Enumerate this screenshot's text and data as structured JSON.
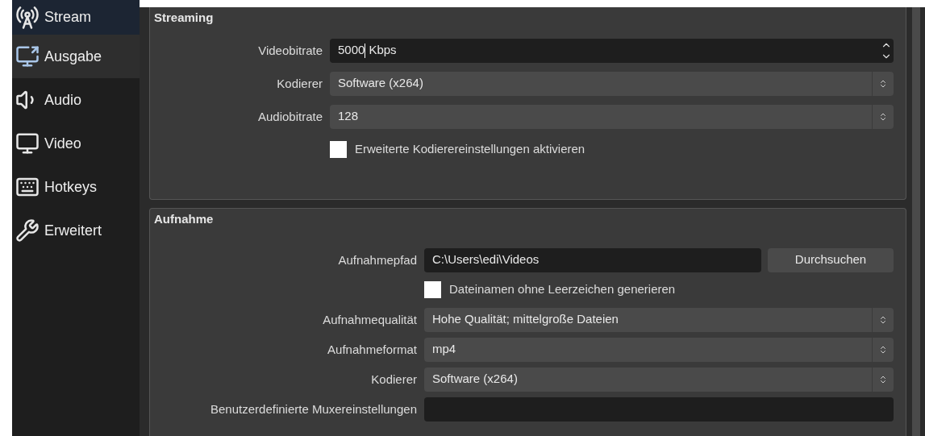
{
  "sidebar": {
    "items": [
      {
        "label": "Stream",
        "selected": false,
        "hovered": true
      },
      {
        "label": "Ausgabe",
        "selected": true,
        "hovered": false
      },
      {
        "label": "Audio",
        "selected": false,
        "hovered": false
      },
      {
        "label": "Video",
        "selected": false,
        "hovered": false
      },
      {
        "label": "Hotkeys",
        "selected": false,
        "hovered": false
      },
      {
        "label": "Erweitert",
        "selected": false,
        "hovered": false
      }
    ]
  },
  "groups": [
    {
      "title": "Streaming",
      "rows": [
        {
          "kind": "spin",
          "label": "Videobitrate",
          "value": "5000",
          "suffix": "Kbps",
          "focused": true
        },
        {
          "kind": "select",
          "label": "Kodierer",
          "value": "Software (x264)"
        },
        {
          "kind": "select",
          "label": "Audiobitrate",
          "value": "128"
        },
        {
          "kind": "checkbox",
          "label": "Erweiterte Kodierereinstellungen aktivieren",
          "checked": false
        }
      ]
    },
    {
      "title": "Aufnahme",
      "rows": [
        {
          "kind": "path",
          "label": "Aufnahmepfad",
          "value": "C:\\Users\\edi\\Videos",
          "button": "Durchsuchen"
        },
        {
          "kind": "checkbox",
          "label": "Dateinamen ohne Leerzeichen generieren",
          "checked": false
        },
        {
          "kind": "select",
          "label": "Aufnahmequalität",
          "value": "Hohe Qualität; mittelgroße Dateien"
        },
        {
          "kind": "select",
          "label": "Aufnahmeformat",
          "value": "mp4"
        },
        {
          "kind": "select",
          "label": "Kodierer",
          "value": "Software (x264)"
        },
        {
          "kind": "text",
          "label": "Benutzerdefinierte Muxereinstellungen",
          "value": ""
        }
      ]
    }
  ]
}
